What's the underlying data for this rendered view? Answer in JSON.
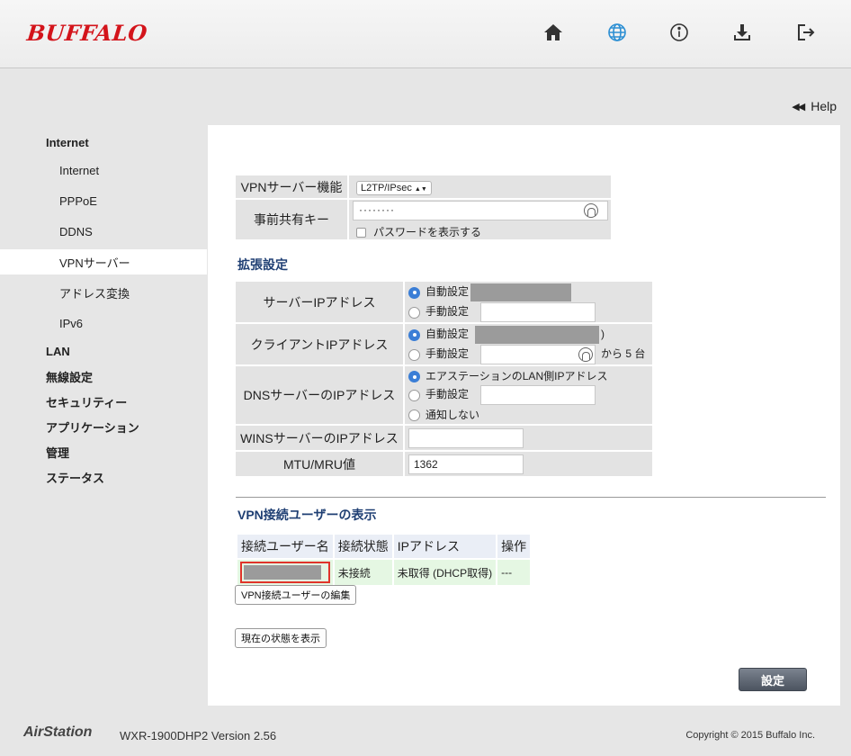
{
  "header": {
    "brand": "BUFFALO",
    "icons": [
      "home-icon",
      "globe-icon",
      "info-icon",
      "download-icon",
      "logout-icon"
    ],
    "accent_color": "#d3141b",
    "active_icon_color": "#2d8fd3"
  },
  "help": {
    "label": "Help"
  },
  "sidebar": {
    "items": [
      {
        "label": "Internet",
        "level": "top"
      },
      {
        "label": "Internet",
        "level": "sub"
      },
      {
        "label": "PPPoE",
        "level": "sub"
      },
      {
        "label": "DDNS",
        "level": "sub"
      },
      {
        "label": "VPNサーバー",
        "level": "sub",
        "active": true
      },
      {
        "label": "アドレス変換",
        "level": "sub"
      },
      {
        "label": "IPv6",
        "level": "sub"
      },
      {
        "label": "LAN",
        "level": "top"
      },
      {
        "label": "無線設定",
        "level": "top"
      },
      {
        "label": "セキュリティー",
        "level": "top"
      },
      {
        "label": "アプリケーション",
        "level": "top"
      },
      {
        "label": "管理",
        "level": "top"
      },
      {
        "label": "ステータス",
        "level": "top"
      }
    ]
  },
  "vpn": {
    "function_label": "VPNサーバー機能",
    "function_value": "L2TP/IPsec",
    "psk_label": "事前共有キー",
    "psk_value": "········",
    "show_password_label": "パスワードを表示する"
  },
  "advanced": {
    "title": "拡張設定",
    "server_ip_label": "サーバーIPアドレス",
    "client_ip_label": "クライアントIPアドレス",
    "dns_label": "DNSサーバーのIPアドレス",
    "wins_label": "WINSサーバーのIPアドレス",
    "mtu_label": "MTU/MRU値",
    "auto": "自動設定",
    "manual": "手動設定",
    "client_paren": ")",
    "client_range_suffix": "から 5 台",
    "dns_option_lan": "エアステーションのLAN側IPアドレス",
    "dns_option_none": "通知しない",
    "wins_value": "",
    "mtu_value": "1362"
  },
  "users": {
    "title": "VPN接続ユーザーの表示",
    "headers": [
      "接続ユーザー名",
      "接続状態",
      "IPアドレス",
      "操作"
    ],
    "row": {
      "status": "未接続",
      "ip": "未取得 (DHCP取得)",
      "op": "---"
    },
    "edit_button": "VPN接続ユーザーの編集",
    "status_button": "現在の状態を表示"
  },
  "submit": {
    "label": "設定"
  },
  "footer": {
    "brand": "AirStation",
    "model": "WXR-1900DHP2   Version 2.56",
    "copyright": "Copyright © 2015 Buffalo Inc."
  }
}
